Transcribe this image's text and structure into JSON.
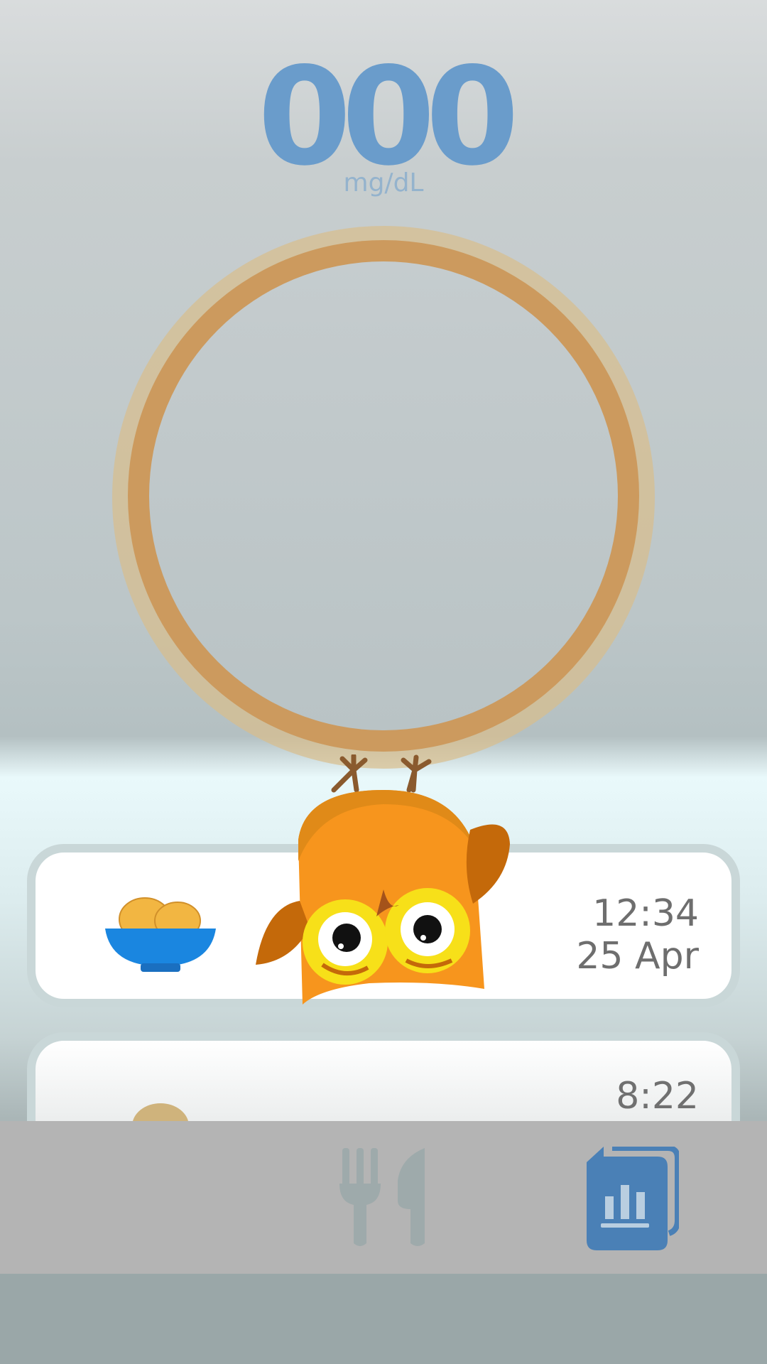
{
  "reading": {
    "value": "000",
    "unit": "mg/dL"
  },
  "entries": [
    {
      "time": "12:34",
      "date": "25 Apr",
      "icon": "food-bowl-icon"
    },
    {
      "time": "8:22",
      "icon": "food-bowl-icon"
    }
  ],
  "nav": {
    "items": [
      {
        "icon": "fork-knife-icon"
      },
      {
        "icon": "stats-book-icon"
      }
    ]
  },
  "colors": {
    "reading": "#6a9ccb",
    "ring": "#cc9a5e",
    "owl": "#f7951d",
    "bowl": "#1a86e0",
    "stats_tab": "#4a80b6",
    "food_tab": "#9eaaab"
  }
}
